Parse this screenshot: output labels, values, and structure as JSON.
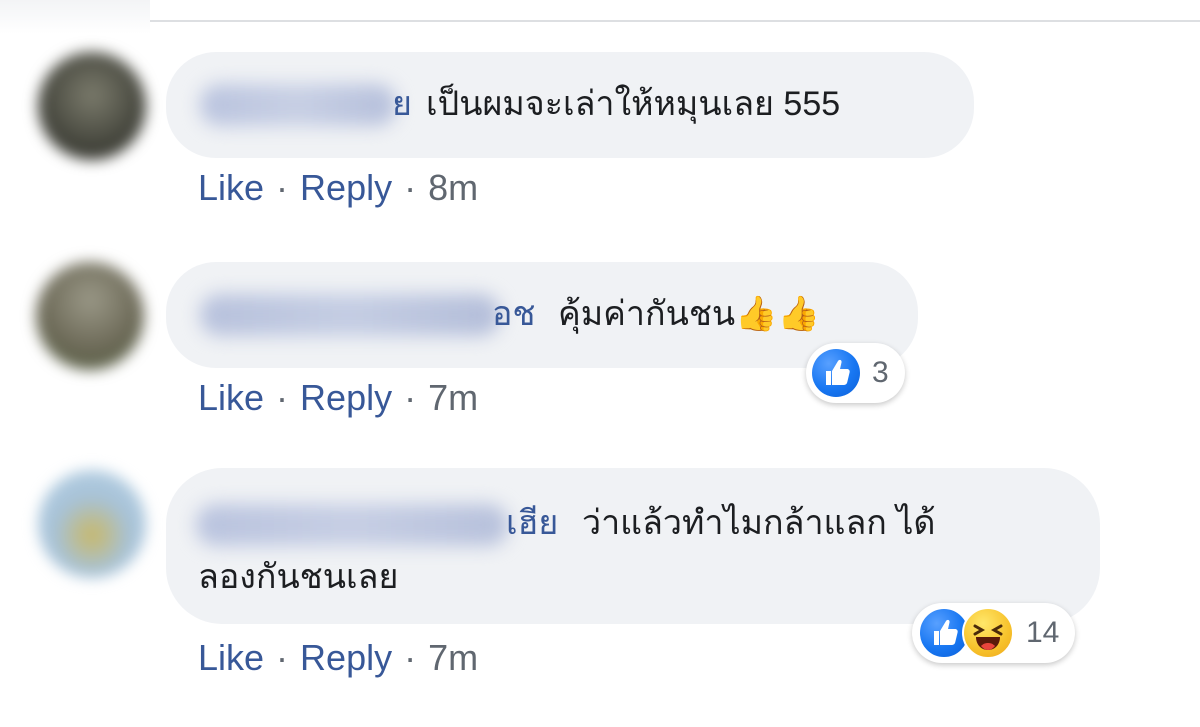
{
  "comments": [
    {
      "name_tail": "ย",
      "text_lines": [
        "เป็นผมจะเล่าให้หมุนเลย 555"
      ],
      "actions": {
        "like": "Like",
        "separator": "·",
        "reply": "Reply",
        "time": "8m"
      },
      "reactions": null,
      "avatar_colors": [
        "#6f6f63",
        "#2f3029"
      ]
    },
    {
      "name_tail": "อช",
      "text_lines": [
        "คุ้มค่ากันชน👍👍"
      ],
      "actions": {
        "like": "Like",
        "separator": "·",
        "reply": "Reply",
        "time": "7m"
      },
      "reactions": {
        "types": [
          "like-icon"
        ],
        "count": "3"
      },
      "avatar_colors": [
        "#8a8a7a",
        "#5c6f47"
      ]
    },
    {
      "name_tail": "เฮีย",
      "text_lines": [
        "ว่าแล้วทำไมกล้าแลก ได้",
        "ลองกันชนเลย"
      ],
      "actions": {
        "like": "Like",
        "separator": "·",
        "reply": "Reply",
        "time": "7m"
      },
      "reactions": {
        "types": [
          "like-icon",
          "haha-icon"
        ],
        "count": "14"
      },
      "avatar_colors": [
        "#a9c6da",
        "#c8b35e"
      ]
    }
  ],
  "colors": {
    "link": "#385898",
    "meta": "#606770",
    "bubble": "#f0f2f5",
    "text": "#1c1e21",
    "like_blue": "#1877f2"
  }
}
